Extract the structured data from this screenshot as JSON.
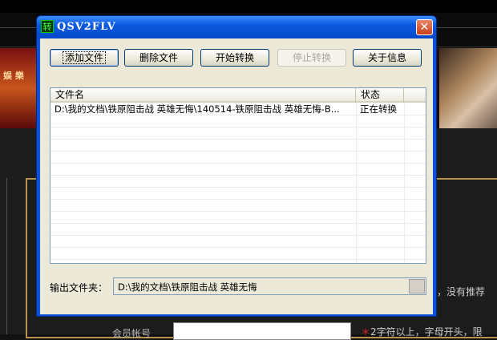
{
  "window": {
    "title": "QSV2FLV",
    "app_icon_glyph": "转",
    "close_glyph": "✕"
  },
  "toolbar": {
    "add_label": "添加文件",
    "delete_label": "删除文件",
    "start_label": "开始转换",
    "stop_label": "停止转换",
    "about_label": "关于信息"
  },
  "file_list": {
    "columns": [
      "文件名",
      "状态"
    ],
    "rows": [
      {
        "filename": "D:\\我的文档\\铁原阻击战 英雄无悔\\140514-铁原阻击战 英雄无悔-B...",
        "status": "正在转换"
      }
    ]
  },
  "output": {
    "label": "输出文件夹：",
    "path": "D:\\我的文档\\铁原阻击战 英雄无悔"
  },
  "background": {
    "banner_text": "娱 樂",
    "side_text": "，没有推荐",
    "field_label": "会员帐号",
    "hint_star": "＊",
    "hint_text": "2字符以上，字母开头，限"
  }
}
